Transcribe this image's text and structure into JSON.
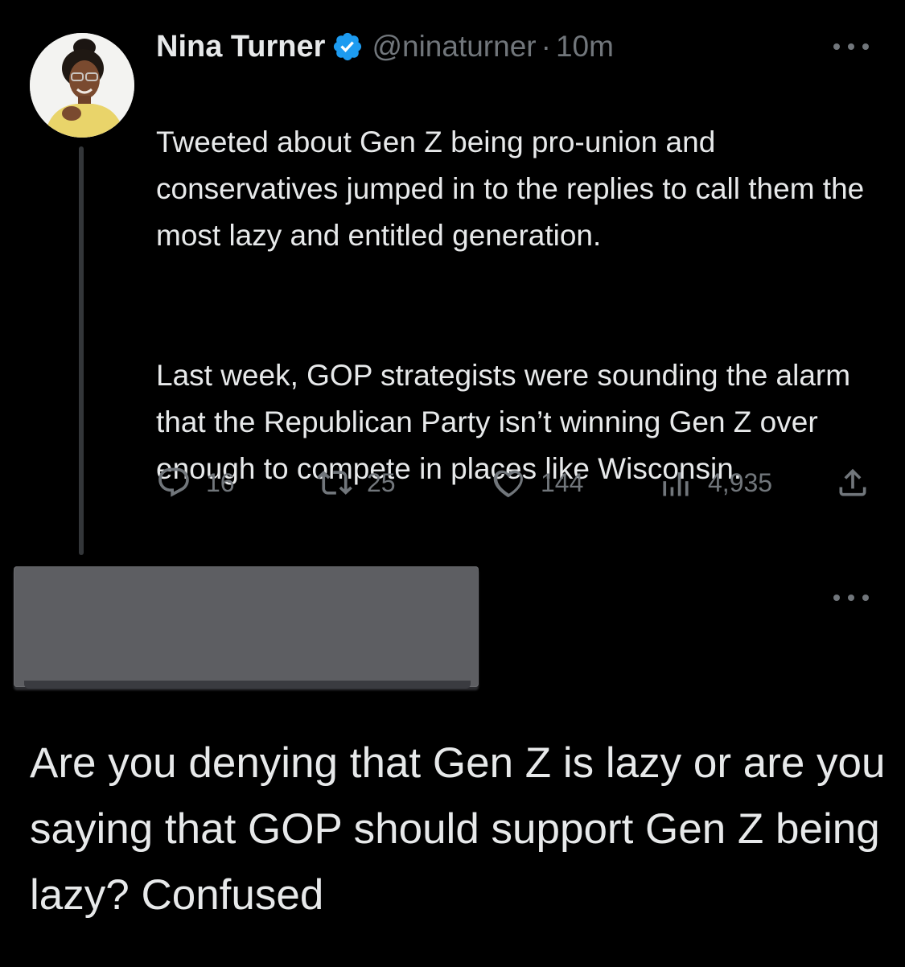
{
  "tweet": {
    "author": {
      "display_name": "Nina Turner",
      "handle": "@ninaturner",
      "verified": true,
      "avatar_icon": "profile-photo"
    },
    "separator": "·",
    "time": "10m",
    "paragraphs": [
      "Tweeted about Gen Z being pro-union and conservatives jumped in to the replies to call them the most lazy and entitled generation.",
      "Last week, GOP strategists were sounding the alarm that the Republican Party isn’t winning Gen Z over enough to compete in places like Wisconsin."
    ],
    "actions": {
      "reply": {
        "icon": "reply-icon",
        "count": "16"
      },
      "retweet": {
        "icon": "retweet-icon",
        "count": "25"
      },
      "like": {
        "icon": "heart-icon",
        "count": "144"
      },
      "views": {
        "icon": "views-bar-chart-icon",
        "count": "4,935"
      },
      "share": {
        "icon": "share-icon"
      }
    },
    "more_icon": "more-horizontal-icon"
  },
  "reply": {
    "author": "redacted",
    "text": "Are you denying that Gen Z is lazy or are you saying that GOP should support Gen Z being lazy? Confused",
    "more_icon": "more-horizontal-icon"
  },
  "colors": {
    "background": "#000000",
    "primary_text": "#e7e9ea",
    "secondary_text": "#71767b",
    "verified_blue": "#1d9bf0",
    "thread_line": "#333639",
    "redaction_gray": "#5d5e62"
  }
}
